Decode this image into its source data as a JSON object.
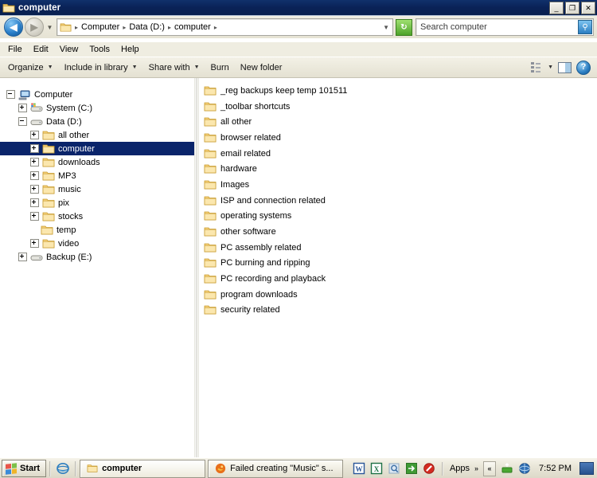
{
  "window": {
    "title": "computer",
    "icon": "folder-icon",
    "controls": [
      {
        "name": "minimize-button",
        "glyph": "_"
      },
      {
        "name": "restore-button",
        "glyph": "❐"
      },
      {
        "name": "close-button",
        "glyph": "✕"
      }
    ]
  },
  "address_bar": {
    "back_label": "◀",
    "forward_label": "▶",
    "history_caret": "▼",
    "breadcrumbs": [
      "Computer",
      "Data (D:)",
      "computer"
    ],
    "separator": "▸",
    "end_caret": "▼",
    "refresh_glyph": "↻"
  },
  "search": {
    "placeholder": "Search computer",
    "icon": "search-icon",
    "glyph": "⚲"
  },
  "menu": {
    "items": [
      "File",
      "Edit",
      "View",
      "Tools",
      "Help"
    ]
  },
  "toolbar": {
    "items": [
      {
        "label": "Organize",
        "has_caret": true
      },
      {
        "label": "Include in library",
        "has_caret": true
      },
      {
        "label": "Share with",
        "has_caret": true
      },
      {
        "label": "Burn",
        "has_caret": false
      },
      {
        "label": "New folder",
        "has_caret": false
      }
    ],
    "caret": "▼",
    "right": {
      "view_icon": "view-layout-icon",
      "view_caret": "▼",
      "preview_pane_icon": "preview-pane-icon",
      "help_icon": "help-icon",
      "help_glyph": "?"
    }
  },
  "nav_tree": {
    "items": [
      {
        "label": "Computer",
        "indent": 0,
        "state": "minus",
        "icon": "computer-icon",
        "selected": false
      },
      {
        "label": "System (C:)",
        "indent": 1,
        "state": "plus",
        "icon": "system-drive-icon",
        "selected": false
      },
      {
        "label": "Data (D:)",
        "indent": 1,
        "state": "minus",
        "icon": "drive-icon",
        "selected": false
      },
      {
        "label": "all other",
        "indent": 2,
        "state": "plus",
        "icon": "folder-icon",
        "selected": false
      },
      {
        "label": "computer",
        "indent": 2,
        "state": "plus",
        "icon": "folder-icon",
        "selected": true
      },
      {
        "label": "downloads",
        "indent": 2,
        "state": "plus",
        "icon": "folder-icon",
        "selected": false
      },
      {
        "label": "MP3",
        "indent": 2,
        "state": "plus",
        "icon": "folder-icon",
        "selected": false
      },
      {
        "label": "music",
        "indent": 2,
        "state": "plus",
        "icon": "folder-icon",
        "selected": false
      },
      {
        "label": "pix",
        "indent": 2,
        "state": "plus",
        "icon": "folder-icon",
        "selected": false
      },
      {
        "label": "stocks",
        "indent": 2,
        "state": "plus",
        "icon": "folder-icon",
        "selected": false
      },
      {
        "label": "temp",
        "indent": 2,
        "state": "none",
        "icon": "folder-icon",
        "selected": false
      },
      {
        "label": "video",
        "indent": 2,
        "state": "plus",
        "icon": "folder-icon",
        "selected": false
      },
      {
        "label": "Backup (E:)",
        "indent": 1,
        "state": "plus",
        "icon": "drive-icon",
        "selected": false
      }
    ]
  },
  "file_list": {
    "items": [
      {
        "name": "_reg backups keep temp 101511",
        "icon": "folder-icon"
      },
      {
        "name": "_toolbar shortcuts",
        "icon": "folder-icon"
      },
      {
        "name": "all other",
        "icon": "folder-icon"
      },
      {
        "name": "browser related",
        "icon": "folder-icon"
      },
      {
        "name": "email related",
        "icon": "folder-icon"
      },
      {
        "name": "hardware",
        "icon": "folder-icon"
      },
      {
        "name": "Images",
        "icon": "folder-icon"
      },
      {
        "name": "ISP and connection related",
        "icon": "folder-icon"
      },
      {
        "name": "operating systems",
        "icon": "folder-icon"
      },
      {
        "name": "other software",
        "icon": "folder-icon"
      },
      {
        "name": "PC assembly related",
        "icon": "folder-icon"
      },
      {
        "name": "PC burning and ripping",
        "icon": "folder-icon"
      },
      {
        "name": "PC recording and playback",
        "icon": "folder-icon"
      },
      {
        "name": "program downloads",
        "icon": "folder-icon"
      },
      {
        "name": "security related",
        "icon": "folder-icon"
      }
    ]
  },
  "taskbar": {
    "start_label": "Start",
    "quick_launch": [
      {
        "name": "internet-explorer-icon"
      }
    ],
    "buttons": [
      {
        "label": "computer",
        "icon": "folder-icon",
        "active": true
      },
      {
        "label": "Failed creating \"Music\" s...",
        "icon": "firefox-icon",
        "active": false
      }
    ],
    "tray_icons": [
      {
        "name": "word-icon"
      },
      {
        "name": "excel-icon"
      },
      {
        "name": "preview-magnifier-icon"
      },
      {
        "name": "green-arrow-icon"
      },
      {
        "name": "block-icon"
      }
    ],
    "apps_label": "Apps",
    "apps_chevron": "»",
    "expand_glyph": "«",
    "tray_right_icons": [
      {
        "name": "safely-remove-icon"
      },
      {
        "name": "network-globe-icon"
      }
    ],
    "clock": "7:52 PM",
    "show_desktop": "show-desktop-button"
  },
  "colors": {
    "titlebar": "#0a2257",
    "selection": "#0a246a",
    "chrome": "#e9e6d8",
    "folder": "#f3c455"
  }
}
